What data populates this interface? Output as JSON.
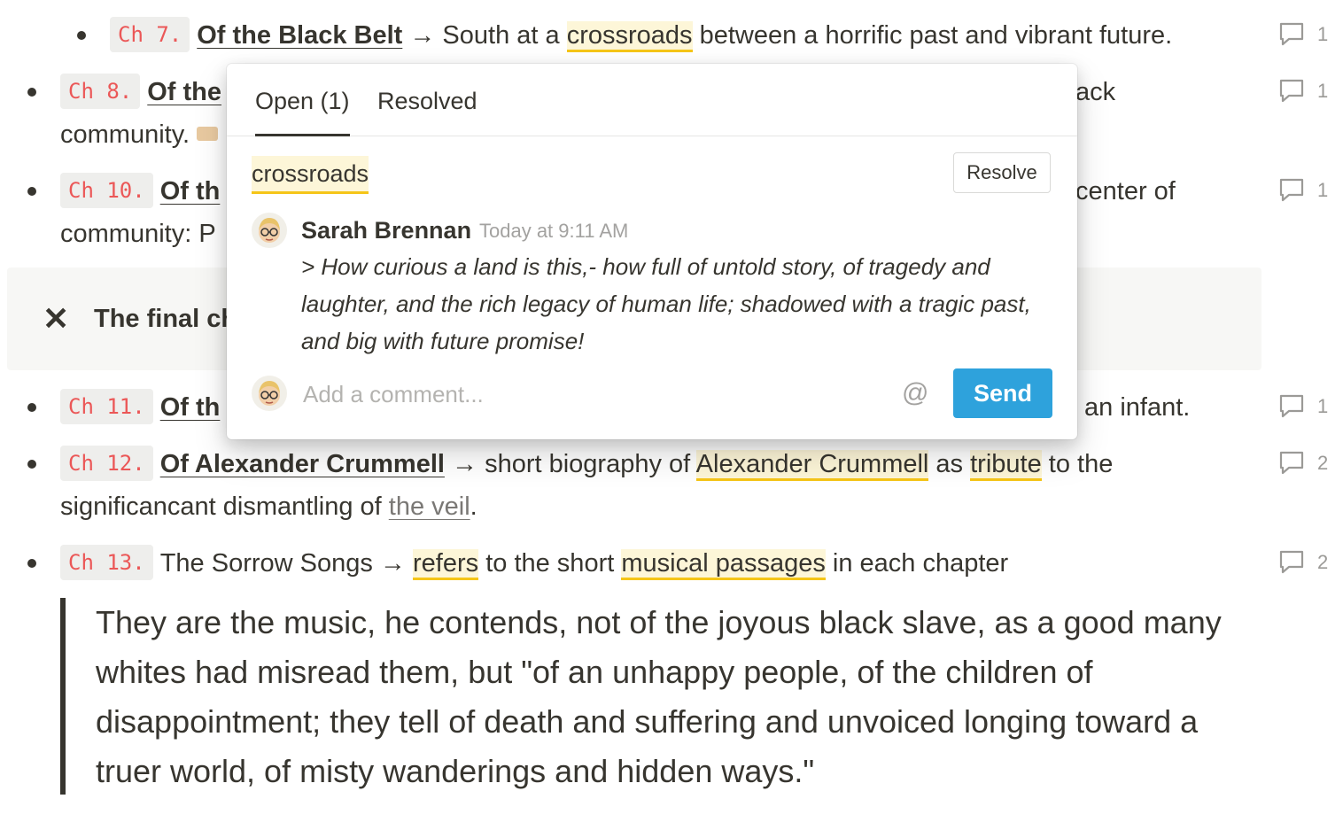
{
  "items": [
    {
      "code": "Ch 7.",
      "title": "Of the Black Belt",
      "arrow": " → South at a ",
      "hl": "crossroads",
      "rest": " between a horrific past and vibrant future.",
      "count": "1"
    },
    {
      "code": "Ch 8.",
      "title_frag": "Of the",
      "tail": "ack",
      "line2": "community.",
      "count": "1"
    },
    {
      "code": "Ch 10.",
      "title_frag": "Of th",
      "tail": "center of",
      "line2": "community: P",
      "count": "1"
    },
    {
      "code": "Ch 11.",
      "title_frag": "Of th",
      "tail": "an infant.",
      "count": "1"
    },
    {
      "code": "Ch 12.",
      "title": "Of Alexander Crummell",
      "arrow": " → short biography of ",
      "hl1": "Alexander Crummell",
      "mid": " as ",
      "hl2": "tribute",
      "rest": " to the",
      "line2a": "significancant dismantling of ",
      "veil": "the veil",
      "line2b": ".",
      "count": "2"
    },
    {
      "code": "Ch 13.",
      "plain": "The Sorrow Songs → ",
      "hl1": "refers",
      "mid": " to the short ",
      "hl2": "musical passages",
      "rest": " in each chapter",
      "count": "2"
    }
  ],
  "callout": {
    "icon": "✕",
    "text": "The final ch"
  },
  "quote": {
    "text": "They are the music, he contends, not of the joyous black slave, as a good many whites had misread them, but \"of an unhappy people, of the children of disappointment; they tell of death and suffering and unvoiced longing toward a truer world, of misty wanderings and hidden ways.\""
  },
  "popup": {
    "tab_open": "Open (1)",
    "tab_resolved": "Resolved",
    "anchor": "crossroads",
    "resolve_label": "Resolve",
    "author": "Sarah Brennan",
    "time": "Today at 9:11 AM",
    "body": "> How curious a land is this,- how full of untold story, of tragedy and laughter, and the rich legacy of human life; shadowed with a tragic past, and big with future promise!",
    "input_placeholder": "Add a comment...",
    "mention": "@",
    "send_label": "Send"
  },
  "colors": {
    "accent": "#2ea2dc",
    "code_red": "#eb5757",
    "highlight_line": "#f5c518",
    "highlight_bg": "#fdf6d8"
  }
}
